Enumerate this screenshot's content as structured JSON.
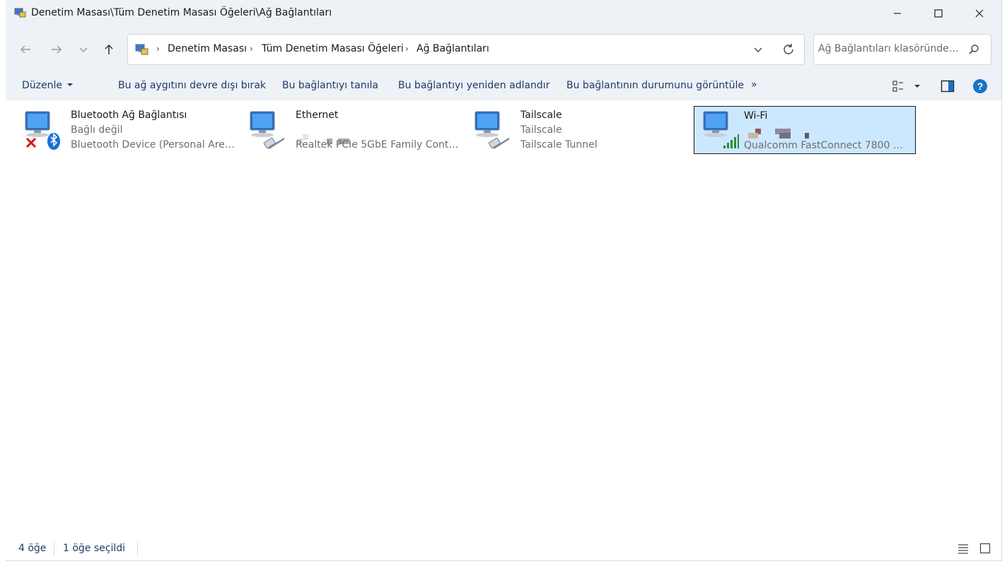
{
  "window": {
    "title": "Denetim Masası\\Tüm Denetim Masası Öğeleri\\Ağ Bağlantıları",
    "controls": [
      "minimize-icon",
      "maximize-icon",
      "close-icon"
    ]
  },
  "nav": {
    "icons": [
      "back-arrow-icon",
      "forward-arrow-icon",
      "recent-locations-chevron-icon",
      "up-arrow-icon"
    ]
  },
  "address": {
    "breadcrumbs": [
      "Denetim Masası",
      "Tüm Denetim Masası Öğeleri",
      "Ağ Bağlantıları"
    ],
    "icons": [
      "dropdown-chevron-icon",
      "refresh-icon"
    ]
  },
  "search": {
    "placeholder": "Ağ Bağlantıları klasöründe a..."
  },
  "toolbar": {
    "organize": "Düzenle",
    "actions": [
      "Bu ağ aygıtını devre dışı bırak",
      "Bu bağlantıyı tanıla",
      "Bu bağlantıyı yeniden adlandır",
      "Bu bağlantının durumunu görüntüle"
    ],
    "more": "»"
  },
  "connections": [
    {
      "name": "Bluetooth Ağ Bağlantısı",
      "status": "Bağlı değil",
      "device": "Bluetooth Device (Personal Area ...",
      "selected": false,
      "icon": "bluetooth-network-icon"
    },
    {
      "name": "Ethernet",
      "status": "",
      "device": "Realtek PCIe 5GbE Family Controll...",
      "selected": false,
      "icon": "ethernet-network-icon"
    },
    {
      "name": "Tailscale",
      "status": "Tailscale",
      "device": "Tailscale Tunnel",
      "selected": false,
      "icon": "ethernet-network-icon"
    },
    {
      "name": "Wi-Fi",
      "status": "",
      "device": "Qualcomm FastConnect 7800 Wi-...",
      "selected": true,
      "icon": "wifi-network-icon"
    }
  ],
  "statusbar": {
    "count": "4 öğe",
    "selected": "1 öğe seçildi"
  },
  "colors": {
    "accent": "#1f3b68",
    "selection": "#cce8ff",
    "chrome": "#eef1f6",
    "help": "#1a73c8"
  }
}
